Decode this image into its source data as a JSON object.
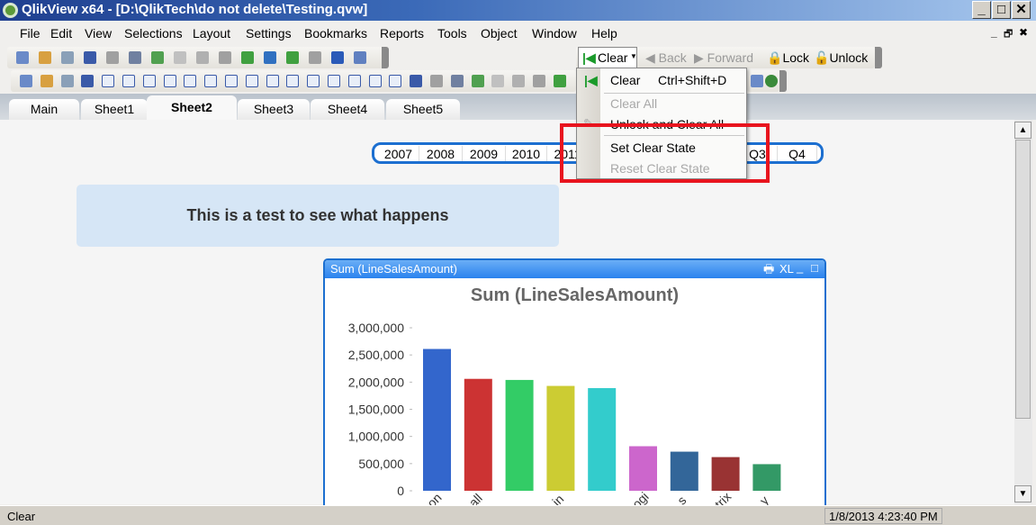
{
  "window": {
    "title": "QlikView x64 - [D:\\QlikTech\\do not delete\\Testing.qvw]",
    "min": "_",
    "max": "□",
    "close": "✕",
    "doc_min": "_",
    "doc_restore": "🗗",
    "doc_close": "✖"
  },
  "menu": [
    "File",
    "Edit",
    "View",
    "Selections",
    "Layout",
    "Settings",
    "Bookmarks",
    "Reports",
    "Tools",
    "Object",
    "Window",
    "Help"
  ],
  "toolbar1_icons": [
    "new-icon",
    "open-icon",
    "reload-icon",
    "save-icon",
    "print-icon",
    "edit-script-icon",
    "reload-data-icon",
    "undo-icon",
    "redo-icon",
    "search-icon",
    "current-selections-icon",
    "wizard-chart-icon",
    "bookmark-icon",
    "edit-icon",
    "help-icon",
    "context-help-icon"
  ],
  "toolbar2_icons": [
    "new-sheet-icon",
    "sheet-left-icon",
    "sheet-right-icon",
    "sheet-properties-icon",
    "listbox-icon",
    "statistics-icon",
    "table-icon",
    "multibox-icon",
    "chart-icon",
    "input-box-icon",
    "current-selections-icon",
    "button-icon",
    "text-object-icon",
    "line-arrow-icon",
    "slider-icon",
    "bookmark-object-icon",
    "search-object-icon",
    "container-icon",
    "custom-object-icon",
    "chart-wizard-icon",
    "format-painter-icon",
    "grid-icon",
    "align-left-icon",
    "align-center-icon",
    "align-right-icon",
    "align-bottom-icon",
    "align-middle-icon"
  ],
  "nav_toolbar": {
    "clear": "Clear",
    "back": "Back",
    "forward": "Forward",
    "lock": "Lock",
    "unlock": "Unlock"
  },
  "clear_menu": {
    "clear": "Clear",
    "clear_shortcut": "Ctrl+Shift+D",
    "clear_all": "Clear All",
    "unlock_clear_all": "Unlock and Clear All",
    "set_clear_state": "Set Clear State",
    "reset_clear_state": "Reset Clear State"
  },
  "tabs": [
    "Main",
    "Sheet1",
    "Sheet2",
    "Sheet3",
    "Sheet4",
    "Sheet5"
  ],
  "active_tab": "Sheet2",
  "listbox": {
    "items": [
      "2007",
      "2008",
      "2009",
      "2010",
      "2011",
      "Q3",
      "Q4"
    ]
  },
  "textbox": "This is a test to see what happens",
  "chart_caption": "Sum (LineSalesAmount)",
  "chart_caption_buttons": {
    "print": "🖶",
    "xl": "XL",
    "min": "_",
    "max": "□"
  },
  "chart_data": {
    "type": "bar",
    "title": "Sum (LineSalesAmount)",
    "categories": [
      "on",
      "all",
      "",
      "in",
      "",
      "ogi",
      "s",
      "trix",
      "y"
    ],
    "values": [
      2610000,
      2060000,
      2040000,
      1930000,
      1890000,
      820000,
      720000,
      620000,
      490000
    ],
    "colors": [
      "#3366cc",
      "#cc3333",
      "#33cc66",
      "#cccc33",
      "#33cccc",
      "#cc66cc",
      "#336699",
      "#993333",
      "#339966"
    ],
    "yticks": [
      "0",
      "500,000",
      "1,000,000",
      "1,500,000",
      "2,000,000",
      "2,500,000",
      "3,000,000"
    ],
    "ylim": [
      0,
      3000000
    ],
    "xlabel": "",
    "ylabel": ""
  },
  "status": {
    "left": "Clear",
    "datetime": "1/8/2013 4:23:40 PM"
  }
}
